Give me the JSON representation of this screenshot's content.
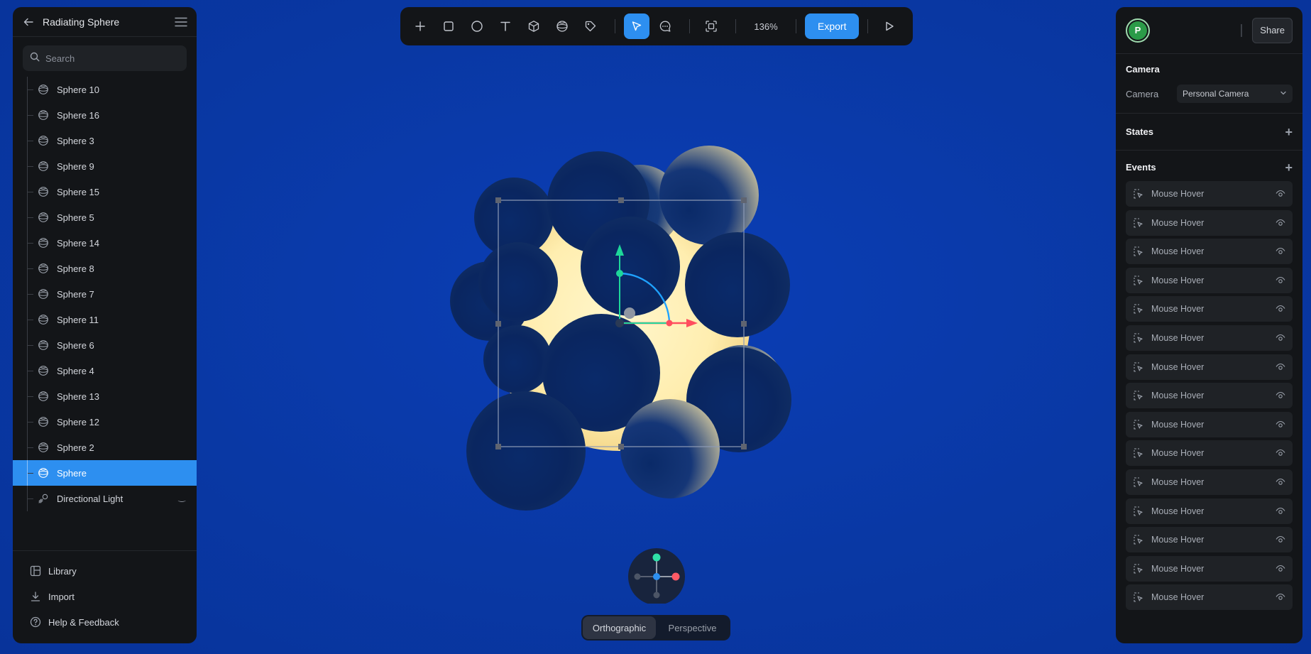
{
  "project": {
    "title": "Radiating Sphere"
  },
  "search": {
    "placeholder": "Search"
  },
  "layers": [
    {
      "label": "Sphere 10",
      "icon": "sphere-icon"
    },
    {
      "label": "Sphere 16",
      "icon": "sphere-icon"
    },
    {
      "label": "Sphere 3",
      "icon": "sphere-icon"
    },
    {
      "label": "Sphere 9",
      "icon": "sphere-icon"
    },
    {
      "label": "Sphere 15",
      "icon": "sphere-icon"
    },
    {
      "label": "Sphere 5",
      "icon": "sphere-icon"
    },
    {
      "label": "Sphere 14",
      "icon": "sphere-icon"
    },
    {
      "label": "Sphere 8",
      "icon": "sphere-icon"
    },
    {
      "label": "Sphere 7",
      "icon": "sphere-icon"
    },
    {
      "label": "Sphere 11",
      "icon": "sphere-icon"
    },
    {
      "label": "Sphere 6",
      "icon": "sphere-icon"
    },
    {
      "label": "Sphere 4",
      "icon": "sphere-icon"
    },
    {
      "label": "Sphere 13",
      "icon": "sphere-icon"
    },
    {
      "label": "Sphere 12",
      "icon": "sphere-icon"
    },
    {
      "label": "Sphere 2",
      "icon": "sphere-icon"
    },
    {
      "label": "Sphere",
      "icon": "sphere-icon",
      "selected": true
    },
    {
      "label": "Directional Light",
      "icon": "light-icon"
    }
  ],
  "footer": {
    "library": "Library",
    "import": "Import",
    "help": "Help & Feedback"
  },
  "toolbar": {
    "tools": [
      "add-icon",
      "rectangle-icon",
      "ellipse-icon",
      "text-icon",
      "cube-icon",
      "sphere-icon",
      "tag-icon",
      "select-icon",
      "comment-icon",
      "frame-icon",
      "play-icon"
    ],
    "active_tool": "select-icon",
    "zoom": "136%",
    "export_label": "Export"
  },
  "right": {
    "avatar_letter": "P",
    "share_label": "Share",
    "camera_section": "Camera",
    "camera_label": "Camera",
    "camera_value": "Personal Camera",
    "states_section": "States",
    "events_section": "Events",
    "events": [
      "Mouse Hover",
      "Mouse Hover",
      "Mouse Hover",
      "Mouse Hover",
      "Mouse Hover",
      "Mouse Hover",
      "Mouse Hover",
      "Mouse Hover",
      "Mouse Hover",
      "Mouse Hover",
      "Mouse Hover",
      "Mouse Hover",
      "Mouse Hover",
      "Mouse Hover",
      "Mouse Hover"
    ]
  },
  "view": {
    "orthographic": "Orthographic",
    "perspective": "Perspective",
    "active": "Orthographic"
  },
  "colors": {
    "accent": "#2d8ff0",
    "canvas": "#0a3aa8",
    "panel": "#131518",
    "glow": "#fff1b8",
    "sphere": "#0c2a66"
  }
}
